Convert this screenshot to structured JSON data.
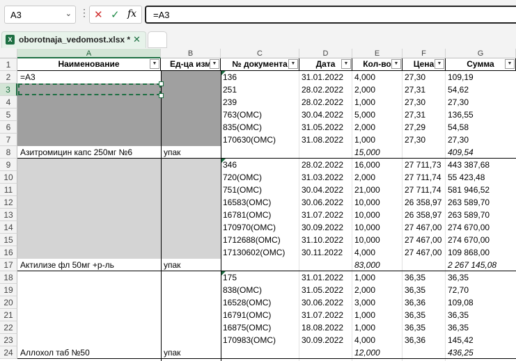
{
  "formula_bar": {
    "name_box": "A3",
    "name_box_icon": "chevron-down-icon",
    "cancel_icon": "✕",
    "enter_icon": "✓",
    "fx_label": "fx",
    "formula": "=A3"
  },
  "tabs": {
    "file_name": "oborotnaja_vedomost.xlsx *",
    "close_icon": "✕",
    "excel_icon": "X"
  },
  "columns": [
    "A",
    "B",
    "C",
    "D",
    "E",
    "F",
    "G"
  ],
  "rows": [
    "1",
    "2",
    "3",
    "4",
    "5",
    "6",
    "7",
    "8",
    "9",
    "10",
    "11",
    "12",
    "13",
    "14",
    "15",
    "16",
    "17",
    "18",
    "19",
    "20",
    "21",
    "22",
    "23",
    "24"
  ],
  "headers": [
    "Наименование",
    "Ед-ца изм",
    "№ документа",
    "Дата",
    "Кол-во",
    "Цена",
    "Сумма"
  ],
  "cells": {
    "a2": "=A3",
    "group1": {
      "name": "Азитромицин капс 250мг №6",
      "unit": "упак",
      "rows": [
        {
          "doc": "136",
          "date": "31.01.2022",
          "qty": "4,000",
          "price": "27,30",
          "sum": "109,19"
        },
        {
          "doc": "251",
          "date": "28.02.2022",
          "qty": "2,000",
          "price": "27,31",
          "sum": "54,62"
        },
        {
          "doc": "239",
          "date": "28.02.2022",
          "qty": "1,000",
          "price": "27,30",
          "sum": "27,30"
        },
        {
          "doc": "763(ОМС)",
          "date": "30.04.2022",
          "qty": "5,000",
          "price": "27,31",
          "sum": "136,55"
        },
        {
          "doc": "835(ОМС)",
          "date": "31.05.2022",
          "qty": "2,000",
          "price": "27,29",
          "sum": "54,58"
        },
        {
          "doc": "170630(ОМС)",
          "date": "31.08.2022",
          "qty": "1,000",
          "price": "27,30",
          "sum": "27,30"
        }
      ],
      "total_qty": "15,000",
      "total_sum": "409,54"
    },
    "group2": {
      "name": "Актилизе фл 50мг +р-ль",
      "unit": "упак",
      "rows": [
        {
          "doc": "346",
          "date": "28.02.2022",
          "qty": "16,000",
          "price": "27 711,73",
          "sum": "443 387,68"
        },
        {
          "doc": "720(ОМС)",
          "date": "31.03.2022",
          "qty": "2,000",
          "price": "27 711,74",
          "sum": "55 423,48"
        },
        {
          "doc": "751(ОМС)",
          "date": "30.04.2022",
          "qty": "21,000",
          "price": "27 711,74",
          "sum": "581 946,52"
        },
        {
          "doc": "16583(ОМС)",
          "date": "30.06.2022",
          "qty": "10,000",
          "price": "26 358,97",
          "sum": "263 589,70"
        },
        {
          "doc": "16781(ОМС)",
          "date": "31.07.2022",
          "qty": "10,000",
          "price": "26 358,97",
          "sum": "263 589,70"
        },
        {
          "doc": "170970(ОМС)",
          "date": "30.09.2022",
          "qty": "10,000",
          "price": "27 467,00",
          "sum": "274 670,00"
        },
        {
          "doc": "1712688(ОМС)",
          "date": "31.10.2022",
          "qty": "10,000",
          "price": "27 467,00",
          "sum": "274 670,00"
        },
        {
          "doc": "17130602(ОМС)",
          "date": "30.11.2022",
          "qty": "4,000",
          "price": "27 467,00",
          "sum": "109 868,00"
        }
      ],
      "total_qty": "83,000",
      "total_sum": "2 267 145,08"
    },
    "group3": {
      "name": "Аллохол таб №50",
      "unit": "упак",
      "rows": [
        {
          "doc": "175",
          "date": "31.01.2022",
          "qty": "1,000",
          "price": "36,35",
          "sum": "36,35"
        },
        {
          "doc": "838(ОМС)",
          "date": "31.05.2022",
          "qty": "2,000",
          "price": "36,35",
          "sum": "72,70"
        },
        {
          "doc": "16528(ОМС)",
          "date": "30.06.2022",
          "qty": "3,000",
          "price": "36,36",
          "sum": "109,08"
        },
        {
          "doc": "16791(ОМС)",
          "date": "31.07.2022",
          "qty": "1,000",
          "price": "36,35",
          "sum": "36,35"
        },
        {
          "doc": "16875(ОМС)",
          "date": "18.08.2022",
          "qty": "1,000",
          "price": "36,35",
          "sum": "36,35"
        },
        {
          "doc": "170983(ОМС)",
          "date": "30.09.2022",
          "qty": "4,000",
          "price": "36,36",
          "sum": "145,42"
        }
      ],
      "total_qty": "12,000",
      "total_sum": "436,25"
    }
  },
  "colors": {
    "excel_green": "#1d6f42",
    "merged_gray_dark": "#a0a0a0",
    "merged_gray_light": "#d4d4d4"
  }
}
